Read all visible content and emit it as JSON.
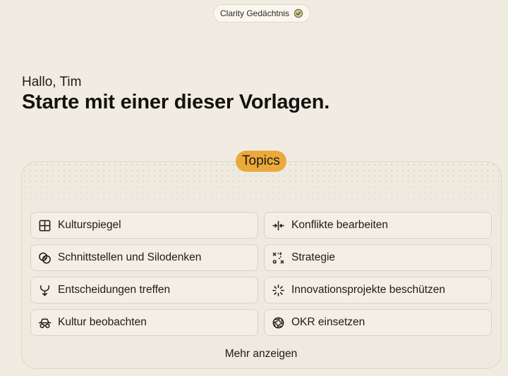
{
  "header": {
    "status_label": "Clarity Gedächtnis",
    "status_icon": "check-circle-icon"
  },
  "hero": {
    "greeting": "Hallo, Tim",
    "headline": "Starte mit einer dieser Vorlagen."
  },
  "topics": {
    "badge": "Topics",
    "badge_color": "#eba93b",
    "items": [
      {
        "label": "Kulturspiegel",
        "icon": "grid-icon"
      },
      {
        "label": "Konflikte bearbeiten",
        "icon": "arrows-collide-icon"
      },
      {
        "label": "Schnittstellen und Silodenken",
        "icon": "overlapping-circles-icon"
      },
      {
        "label": "Strategie",
        "icon": "tactics-icon"
      },
      {
        "label": "Entscheidungen treffen",
        "icon": "merge-arrow-icon"
      },
      {
        "label": "Innovationsprojekte beschützen",
        "icon": "loader-burst-icon"
      },
      {
        "label": "Kultur beobachten",
        "icon": "spy-glasses-icon"
      },
      {
        "label": "OKR einsetzen",
        "icon": "aperture-icon"
      }
    ],
    "more_label": "Mehr anzeigen"
  }
}
